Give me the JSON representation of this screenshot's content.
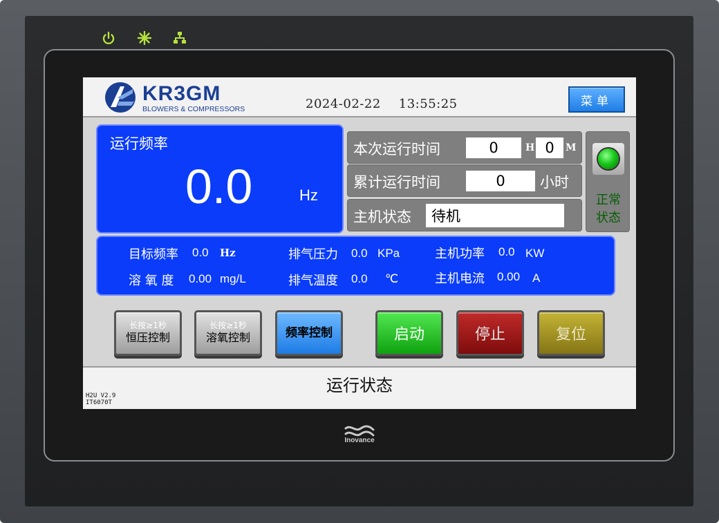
{
  "header": {
    "logo": {
      "brand": "KR3GM",
      "tagline": "BLOWERS & COMPRESSORS"
    },
    "date": "2024-02-22",
    "time": "13:55:25",
    "menu_label": "菜单"
  },
  "frequency": {
    "title": "运行频率",
    "value": "0.0",
    "unit": "Hz"
  },
  "run_time": {
    "label": "本次运行时间",
    "hours": "0",
    "hours_unit": "H",
    "minutes": "0",
    "minutes_unit": "M"
  },
  "total_time": {
    "label": "累计运行时间",
    "value": "0",
    "unit": "小时"
  },
  "host_state": {
    "label": "主机状态",
    "value": "待机"
  },
  "status_indicator": {
    "line1": "正常",
    "line2": "状态",
    "color": "#18c818"
  },
  "info": {
    "target_freq": {
      "label": "目标频率",
      "value": "0.0",
      "unit": "Hz"
    },
    "dissolved_oxygen": {
      "label": "溶 氧 度",
      "value": "0.00",
      "unit": "mg/L"
    },
    "exhaust_pressure": {
      "label": "排气压力",
      "value": "0.0",
      "unit": "KPa"
    },
    "exhaust_temp": {
      "label": "排气温度",
      "value": "0.0",
      "unit": "℃"
    },
    "host_power": {
      "label": "主机功率",
      "value": "0.0",
      "unit": "KW"
    },
    "host_current": {
      "label": "主机电流",
      "value": "0.00",
      "unit": "A"
    }
  },
  "buttons": {
    "constant_pressure": {
      "hint": "长按≥1秒",
      "label": "恒压控制"
    },
    "oxygen_control": {
      "hint": "长按≥1秒",
      "label": "溶氧控制"
    },
    "frequency_control": {
      "label": "频率控制"
    },
    "start": {
      "label": "启动"
    },
    "stop": {
      "label": "停止"
    },
    "reset": {
      "label": "复位"
    }
  },
  "footer": {
    "title": "运行状态",
    "version_line1": "H2U V2.9",
    "version_line2": "IT6070T"
  },
  "bezel": {
    "brand": "Inovance"
  },
  "colors": {
    "panel_blue": "#0a3cfa",
    "gray_panel": "#7f7f7f",
    "led_green": "#b7e23c"
  }
}
